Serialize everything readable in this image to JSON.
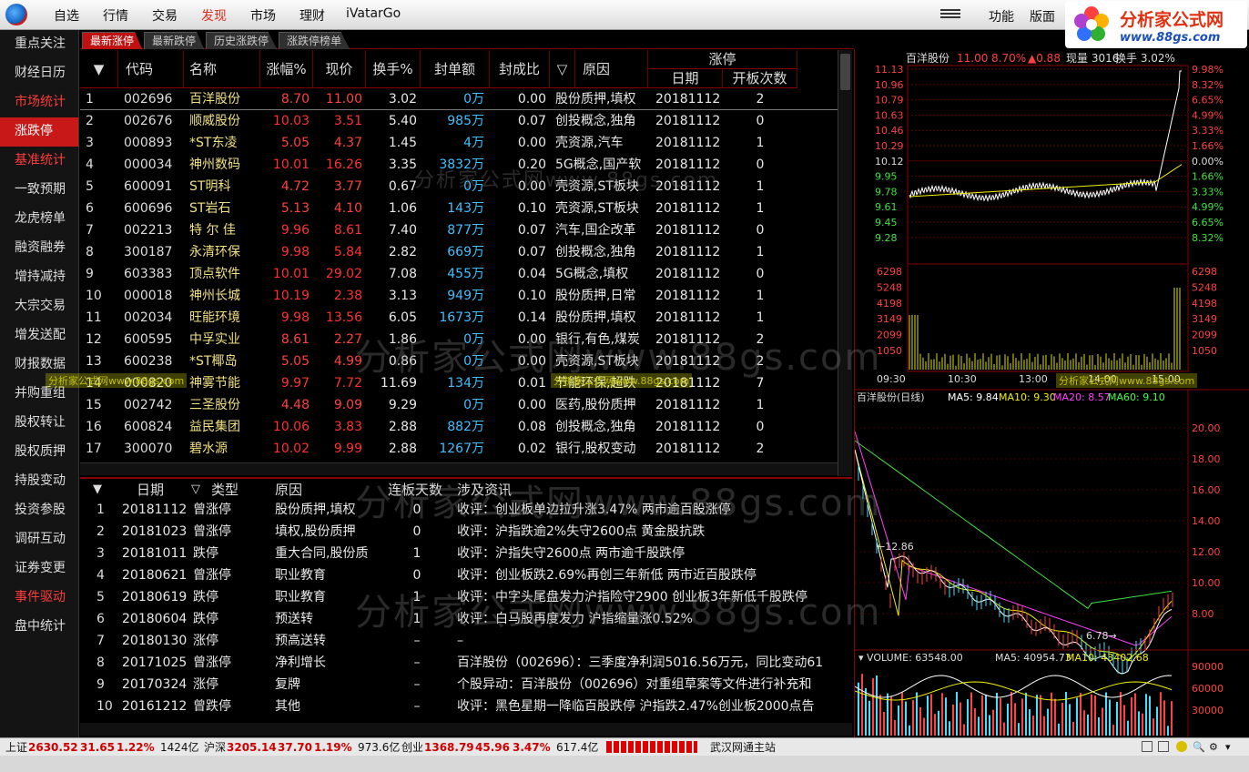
{
  "menu": {
    "items": [
      "自选",
      "行情",
      "交易",
      "发现",
      "市场",
      "理财",
      "iVatarGo"
    ],
    "active_index": 3,
    "right": [
      "功能",
      "版面"
    ]
  },
  "brand": {
    "name": "分析家公式网",
    "url": "www.88gs.com"
  },
  "sidebar": {
    "items": [
      {
        "label": "重点关注",
        "style": "normal"
      },
      {
        "label": "财经日历",
        "style": "normal"
      },
      {
        "label": "市场统计",
        "style": "red"
      },
      {
        "label": "涨跌停",
        "style": "selected"
      },
      {
        "label": "基准统计",
        "style": "red"
      },
      {
        "label": "一致预期",
        "style": "normal"
      },
      {
        "label": "龙虎榜单",
        "style": "normal"
      },
      {
        "label": "融资融券",
        "style": "normal"
      },
      {
        "label": "增持减持",
        "style": "normal"
      },
      {
        "label": "大宗交易",
        "style": "normal"
      },
      {
        "label": "增发送配",
        "style": "normal"
      },
      {
        "label": "财报数据",
        "style": "normal"
      },
      {
        "label": "并购重组",
        "style": "normal"
      },
      {
        "label": "股权转让",
        "style": "normal"
      },
      {
        "label": "股权质押",
        "style": "normal"
      },
      {
        "label": "持股变动",
        "style": "normal"
      },
      {
        "label": "投资参股",
        "style": "normal"
      },
      {
        "label": "调研互动",
        "style": "normal"
      },
      {
        "label": "证券变更",
        "style": "normal"
      },
      {
        "label": "事件驱动",
        "style": "red"
      },
      {
        "label": "盘中统计",
        "style": "normal"
      }
    ]
  },
  "tabs": [
    "最新涨停",
    "最新跌停",
    "历史涨跌停",
    "涨跌停榜单"
  ],
  "table1": {
    "headers": {
      "code": "代码",
      "name": "名称",
      "pct": "涨幅%",
      "price": "现价",
      "turnover": "换手%",
      "seal": "封单额",
      "ratio": "封成比",
      "reason": "原因",
      "group": "涨停",
      "date": "日期",
      "opens": "开板次数"
    },
    "rows": [
      {
        "n": "1",
        "code": "002696",
        "name": "百洋股份",
        "pct": "8.70",
        "price": "11.00",
        "turn": "3.02",
        "seal": "0万",
        "ratio": "0.00",
        "reason": "股份质押,填权",
        "date": "20181112",
        "opens": "2"
      },
      {
        "n": "2",
        "code": "002676",
        "name": "顺威股份",
        "pct": "10.03",
        "price": "3.51",
        "turn": "5.40",
        "seal": "985万",
        "ratio": "0.07",
        "reason": "创投概念,独角",
        "date": "20181112",
        "opens": "0"
      },
      {
        "n": "3",
        "code": "000893",
        "name": "*ST东凌",
        "pct": "5.05",
        "price": "4.37",
        "turn": "1.45",
        "seal": "4万",
        "ratio": "0.00",
        "reason": "壳资源,汽车",
        "date": "20181112",
        "opens": "1"
      },
      {
        "n": "4",
        "code": "000034",
        "name": "神州数码",
        "pct": "10.01",
        "price": "16.26",
        "turn": "3.35",
        "seal": "3832万",
        "ratio": "0.20",
        "reason": "5G概念,国产软",
        "date": "20181112",
        "opens": "0"
      },
      {
        "n": "5",
        "code": "600091",
        "name": "ST明科",
        "pct": "4.72",
        "price": "3.77",
        "turn": "0.67",
        "seal": "0万",
        "ratio": "0.00",
        "reason": "壳资源,ST板块",
        "date": "20181112",
        "opens": "1"
      },
      {
        "n": "6",
        "code": "600696",
        "name": "ST岩石",
        "pct": "5.13",
        "price": "4.10",
        "turn": "1.06",
        "seal": "143万",
        "ratio": "0.10",
        "reason": "壳资源,ST板块",
        "date": "20181112",
        "opens": "1"
      },
      {
        "n": "7",
        "code": "002213",
        "name": "特 尔 佳",
        "pct": "9.96",
        "price": "8.61",
        "turn": "7.40",
        "seal": "877万",
        "ratio": "0.07",
        "reason": "汽车,国企改革",
        "date": "20181112",
        "opens": "0"
      },
      {
        "n": "8",
        "code": "300187",
        "name": "永清环保",
        "pct": "9.98",
        "price": "5.84",
        "turn": "2.82",
        "seal": "669万",
        "ratio": "0.07",
        "reason": "创投概念,独角",
        "date": "20181112",
        "opens": "1"
      },
      {
        "n": "9",
        "code": "603383",
        "name": "顶点软件",
        "pct": "10.01",
        "price": "29.02",
        "turn": "7.08",
        "seal": "455万",
        "ratio": "0.04",
        "reason": "5G概念,填权",
        "date": "20181112",
        "opens": "0"
      },
      {
        "n": "10",
        "code": "000018",
        "name": "神州长城",
        "pct": "10.19",
        "price": "2.38",
        "turn": "3.13",
        "seal": "949万",
        "ratio": "0.10",
        "reason": "股份质押,日常",
        "date": "20181112",
        "opens": "1"
      },
      {
        "n": "11",
        "code": "002034",
        "name": "旺能环境",
        "pct": "9.98",
        "price": "13.56",
        "turn": "6.05",
        "seal": "1673万",
        "ratio": "0.14",
        "reason": "股份质押,填权",
        "date": "20181112",
        "opens": "1"
      },
      {
        "n": "12",
        "code": "600595",
        "name": "中孚实业",
        "pct": "8.61",
        "price": "2.27",
        "turn": "1.86",
        "seal": "0万",
        "ratio": "0.00",
        "reason": "银行,有色,煤炭",
        "date": "20181112",
        "opens": "2"
      },
      {
        "n": "13",
        "code": "600238",
        "name": "*ST椰岛",
        "pct": "5.05",
        "price": "4.99",
        "turn": "0.86",
        "seal": "0万",
        "ratio": "0.00",
        "reason": "壳资源,ST板块",
        "date": "20181112",
        "opens": "2"
      },
      {
        "n": "14",
        "code": "000820",
        "name": "神雾节能",
        "pct": "9.97",
        "price": "7.72",
        "turn": "11.69",
        "seal": "134万",
        "ratio": "0.01",
        "reason": "节能环保,超跌",
        "date": "20181112",
        "opens": "7"
      },
      {
        "n": "15",
        "code": "002742",
        "name": "三圣股份",
        "pct": "4.48",
        "price": "9.09",
        "turn": "9.29",
        "seal": "0万",
        "ratio": "0.00",
        "reason": "医药,股份质押",
        "date": "20181112",
        "opens": "1"
      },
      {
        "n": "16",
        "code": "600824",
        "name": "益民集团",
        "pct": "10.06",
        "price": "3.83",
        "turn": "2.88",
        "seal": "882万",
        "ratio": "0.08",
        "reason": "创投概念,独角",
        "date": "20181112",
        "opens": "0"
      },
      {
        "n": "17",
        "code": "300070",
        "name": "碧水源",
        "pct": "10.02",
        "price": "9.99",
        "turn": "2.88",
        "seal": "1267万",
        "ratio": "0.02",
        "reason": "银行,股权变动",
        "date": "20181112",
        "opens": "2"
      }
    ]
  },
  "table2": {
    "headers": {
      "date": "日期",
      "type": "类型",
      "reason": "原因",
      "days": "连板天数",
      "news": "涉及资讯"
    },
    "rows": [
      {
        "n": "1",
        "date": "20181112",
        "type": "曾涨停",
        "reason": "股份质押,填权",
        "days": "0",
        "news": "收评：创业板单边拉升涨3.47% 两市逾百股涨停"
      },
      {
        "n": "2",
        "date": "20181023",
        "type": "曾涨停",
        "reason": "填权,股份质押",
        "days": "0",
        "news": "收评：沪指跌逾2%失守2600点 黄金股抗跌"
      },
      {
        "n": "3",
        "date": "20181011",
        "type": "跌停",
        "reason": "重大合同,股份质",
        "days": "1",
        "news": "收评：沪指失守2600点 两市逾千股跌停"
      },
      {
        "n": "4",
        "date": "20180621",
        "type": "曾涨停",
        "reason": "职业教育",
        "days": "0",
        "news": "收评：创业板跌2.69%再创三年新低 两市近百股跌停"
      },
      {
        "n": "5",
        "date": "20180619",
        "type": "跌停",
        "reason": "职业教育",
        "days": "1",
        "news": "收评：中字头尾盘发力沪指险守2900 创业板3年新低千股跌停"
      },
      {
        "n": "6",
        "date": "20180604",
        "type": "跌停",
        "reason": "预送转",
        "days": "1",
        "news": "收评：白马股再度发力 沪指缩量涨0.52%"
      },
      {
        "n": "7",
        "date": "20180130",
        "type": "涨停",
        "reason": "预高送转",
        "days": "–",
        "news": "–"
      },
      {
        "n": "8",
        "date": "20171025",
        "type": "曾涨停",
        "reason": "净利增长",
        "days": "–",
        "news": "百洋股份（002696）：三季度净利润5016.56万元，同比变动61"
      },
      {
        "n": "9",
        "date": "20170324",
        "type": "涨停",
        "reason": "复牌",
        "days": "–",
        "news": "个股异动：百洋股份（002696）对重组草案等文件进行补充和"
      },
      {
        "n": "10",
        "date": "20161212",
        "type": "曾跌停",
        "reason": "其他",
        "days": "–",
        "news": "收评：黑色星期一降临百股跌停 沪指跌2.47%创业板2000点告"
      }
    ]
  },
  "intraday": {
    "header": {
      "name": "百洋股份",
      "price": "11.00",
      "pct": "8.70%",
      "change": "▲0.88",
      "vol_label": "现量",
      "vol": "3016",
      "turn_label": "换手",
      "turn": "3.02%"
    },
    "price_labels": [
      "11.13",
      "10.96",
      "10.79",
      "10.63",
      "10.46",
      "10.29",
      "10.12",
      "9.95",
      "9.78",
      "9.61",
      "9.45",
      "9.28"
    ],
    "pct_labels": [
      "9.98%",
      "8.32%",
      "6.65%",
      "4.99%",
      "3.33%",
      "1.66%",
      "0.00%",
      "1.66%",
      "3.33%",
      "4.99%",
      "6.65%",
      "8.32%"
    ],
    "vol_labels": [
      "6298",
      "5248",
      "4198",
      "3149",
      "2099",
      "1050"
    ],
    "time_labels": [
      "09:30",
      "10:30",
      "13:00",
      "14:00",
      "15:00"
    ]
  },
  "daily": {
    "title": "百洋股份(日线)",
    "ma": [
      {
        "label": "MA5: 9.84",
        "color": "#ffffff"
      },
      {
        "label": "MA10: 9.30",
        "color": "#f0f000"
      },
      {
        "label": "MA20: 8.57",
        "color": "#ff40ff"
      },
      {
        "label": "MA60: 9.10",
        "color": "#40ff40"
      }
    ],
    "y_labels": [
      "20.00",
      "18.00",
      "16.00",
      "14.00",
      "12.00",
      "10.00",
      "8.00"
    ],
    "high_mark": "12.86",
    "low_mark": "6.78",
    "volume_header": {
      "label": "VOLUME: 63548.00",
      "ma5": "MA5: 40954.73",
      "ma10": "MA10: 43402.68"
    },
    "vol_labels": [
      "90000",
      "60000",
      "30000"
    ]
  },
  "status": {
    "sh_label": "上证",
    "sh": "2630.52",
    "sh_chg": "31.65",
    "sh_pct": "1.22%",
    "sh_amt": "1424亿",
    "sz_label": "沪深",
    "sz": "3205.14",
    "sz_chg": "37.70",
    "sz_pct": "1.19%",
    "sz_amt": "973.6亿",
    "cy_label": "创业",
    "cy": "1368.79",
    "cy_chg": "45.96",
    "cy_pct": "3.47%",
    "cy_amt": "617.4亿",
    "server": "武汉网通主站"
  },
  "watermark": "分析家公式网www.88gs.com"
}
